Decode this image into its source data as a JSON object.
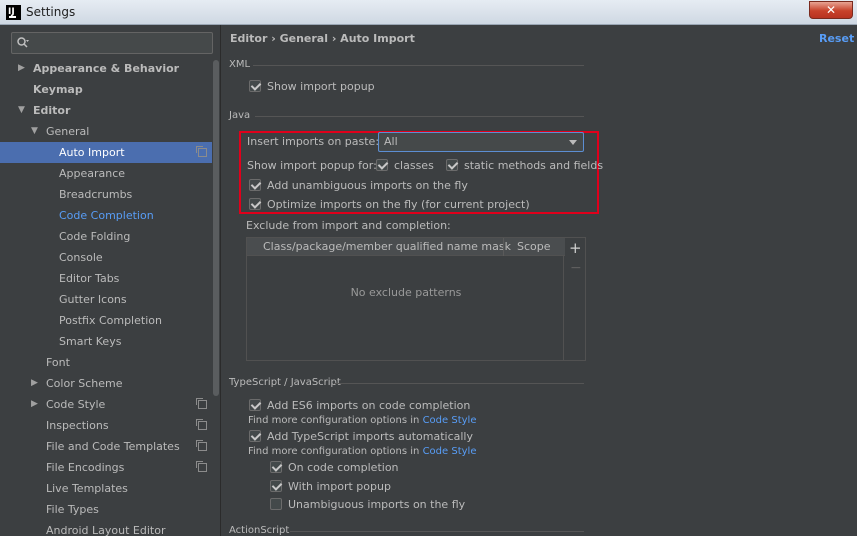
{
  "window": {
    "title": "Settings",
    "app_icon": "IJ"
  },
  "search": {
    "placeholder": ""
  },
  "sidebar": {
    "items": [
      {
        "label": "Appearance & Behavior",
        "arrow": "▶"
      },
      {
        "label": "Keymap"
      },
      {
        "label": "Editor",
        "arrow": "▼"
      },
      {
        "label": "General",
        "arrow": "▼"
      },
      {
        "label": "Auto Import"
      },
      {
        "label": "Appearance"
      },
      {
        "label": "Breadcrumbs"
      },
      {
        "label": "Code Completion"
      },
      {
        "label": "Code Folding"
      },
      {
        "label": "Console"
      },
      {
        "label": "Editor Tabs"
      },
      {
        "label": "Gutter Icons"
      },
      {
        "label": "Postfix Completion"
      },
      {
        "label": "Smart Keys"
      },
      {
        "label": "Font"
      },
      {
        "label": "Color Scheme",
        "arrow": "▶"
      },
      {
        "label": "Code Style",
        "arrow": "▶"
      },
      {
        "label": "Inspections"
      },
      {
        "label": "File and Code Templates"
      },
      {
        "label": "File Encodings"
      },
      {
        "label": "Live Templates"
      },
      {
        "label": "File Types"
      },
      {
        "label": "Android Layout Editor"
      }
    ]
  },
  "main": {
    "breadcrumb": "Editor  ›  General  ›  Auto Import",
    "reset_label": "Reset",
    "xml": {
      "title": "XML",
      "show_import_popup": "Show import popup"
    },
    "java": {
      "title": "Java",
      "insert_on_paste_label": "Insert imports on paste:",
      "insert_on_paste_value": "All",
      "show_popup_for_label": "Show import popup for:",
      "classes_label": "classes",
      "static_label": "static methods and fields",
      "unambiguous_label": "Add unambiguous imports on the fly",
      "optimize_label": "Optimize imports on the fly (for current project)",
      "exclude_label": "Exclude from import and completion:",
      "table": {
        "columns": [
          "Class/package/member qualified name mask",
          "Scope"
        ],
        "empty_text": "No exclude patterns"
      },
      "add_symbol": "+",
      "remove_symbol": "−"
    },
    "ts": {
      "title": "TypeScript / JavaScript",
      "es6_label": "Add ES6 imports on code completion",
      "find_more_1": "Find more configuration options in ",
      "code_style_1": "Code Style",
      "ts_auto_label": "Add TypeScript imports automatically",
      "find_more_2": "Find more configuration options in ",
      "code_style_2": "Code Style",
      "on_completion_label": "On code completion",
      "with_popup_label": "With import popup",
      "unambiguous_fly_label": "Unambiguous imports on the fly"
    },
    "action_script": {
      "title": "ActionScript"
    }
  }
}
